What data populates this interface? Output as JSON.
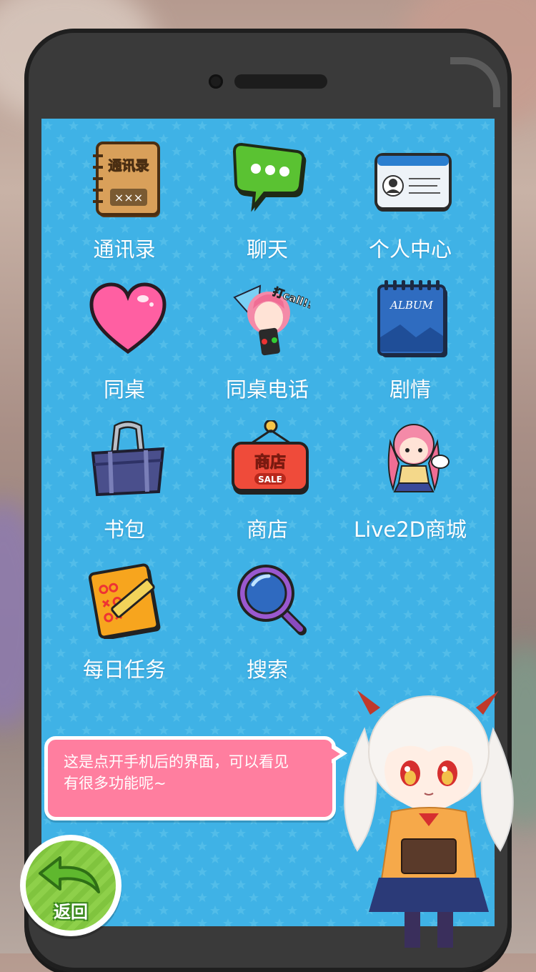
{
  "apps": [
    {
      "label": "通讯录",
      "icon": "address-book-icon",
      "icon_text": "通讯录",
      "icon_subtext": "×××"
    },
    {
      "label": "聊天",
      "icon": "chat-bubble-icon"
    },
    {
      "label": "个人中心",
      "icon": "student-id-card-icon"
    },
    {
      "label": "同桌",
      "icon": "heart-icon"
    },
    {
      "label": "同桌电话",
      "icon": "girl-phone-call-icon",
      "icon_text": "打call!!"
    },
    {
      "label": "剧情",
      "icon": "album-icon",
      "icon_text": "ALBUM"
    },
    {
      "label": "书包",
      "icon": "school-bag-icon"
    },
    {
      "label": "商店",
      "icon": "shop-sign-icon",
      "icon_text": "商店",
      "icon_subtext": "SALE"
    },
    {
      "label": "Live2D商城",
      "icon": "live2d-girl-icon"
    },
    {
      "label": "每日任务",
      "icon": "daily-task-checklist-icon"
    },
    {
      "label": "搜索",
      "icon": "magnifier-icon"
    }
  ],
  "dialog": {
    "text_line1": "这是点开手机后的界面，可以看见",
    "text_line2": "有很多功能呢~"
  },
  "back_button": {
    "label": "返回",
    "icon": "back-arrow-icon"
  },
  "colors": {
    "screen_bg": "#3fb2e6",
    "bubble_bg": "#ff7e9f",
    "back_green": "#8ed04a",
    "phone_frame": "#3a3a3a"
  }
}
